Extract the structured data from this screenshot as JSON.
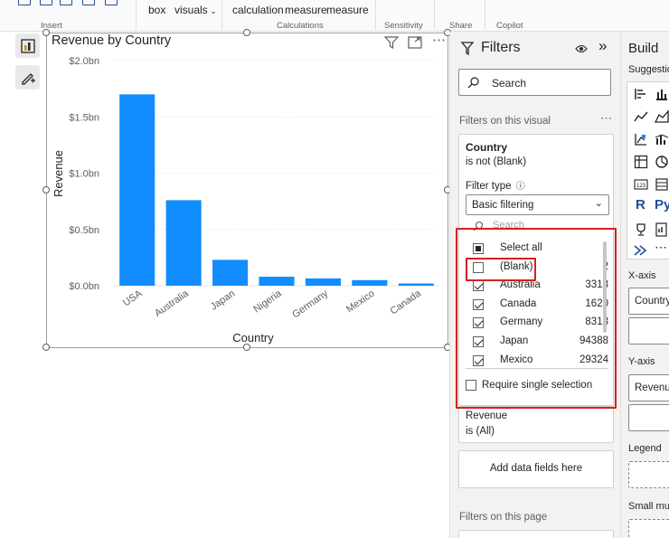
{
  "ribbon": {
    "items": [
      "box",
      "visuals",
      "calculation",
      "measure",
      "measure"
    ],
    "groups": [
      "Insert",
      "Calculations",
      "Sensitivity",
      "Share",
      "Copilot"
    ]
  },
  "chart": {
    "title": "Revenue by Country"
  },
  "chart_data": {
    "type": "bar",
    "title": "Revenue by Country",
    "xlabel": "Country",
    "ylabel": "Revenue",
    "categories": [
      "USA",
      "Australia",
      "Japan",
      "Nigeria",
      "Germany",
      "Mexico",
      "Canada"
    ],
    "values": [
      1.7,
      0.76,
      0.23,
      0.08,
      0.065,
      0.05,
      0.02
    ],
    "value_unit": "bn",
    "yticks": [
      "$0.0bn",
      "$0.5bn",
      "$1.0bn",
      "$1.5bn",
      "$2.0bn"
    ],
    "ytick_values": [
      0,
      0.5,
      1.0,
      1.5,
      2.0
    ],
    "ylim": [
      0,
      2.0
    ],
    "bar_color": "#118dff",
    "grid": true
  },
  "filters": {
    "title": "Filters",
    "search_placeholder": "Search",
    "on_visual_label": "Filters on this visual",
    "on_page_label": "Filters on this page",
    "country_card": {
      "title": "Country",
      "subtitle": "is not (Blank)",
      "filter_type_label": "Filter type",
      "filter_type_value": "Basic filtering",
      "search_placeholder": "Search",
      "items": [
        {
          "label": "Select all",
          "count": "",
          "state": "partial"
        },
        {
          "label": "(Blank)",
          "count": "2",
          "state": "unchecked"
        },
        {
          "label": "Australia",
          "count": "3313",
          "state": "checked"
        },
        {
          "label": "Canada",
          "count": "1620",
          "state": "checked"
        },
        {
          "label": "Germany",
          "count": "8313",
          "state": "checked"
        },
        {
          "label": "Japan",
          "count": "94388",
          "state": "checked"
        },
        {
          "label": "Mexico",
          "count": "29324",
          "state": "checked"
        }
      ],
      "require_single": "Require single selection"
    },
    "revenue_card": {
      "title": "Revenue",
      "subtitle": "is (All)"
    },
    "add_fields": "Add data fields here"
  },
  "build": {
    "title": "Build",
    "suggestions": "Suggestion",
    "xaxis": "X-axis",
    "xaxis_value": "Country",
    "yaxis": "Y-axis",
    "yaxis_value": "Revenue",
    "legend": "Legend",
    "small_multiples": "Small mul"
  },
  "colors": {
    "accent": "#118dff",
    "highlight": "#d32020"
  }
}
